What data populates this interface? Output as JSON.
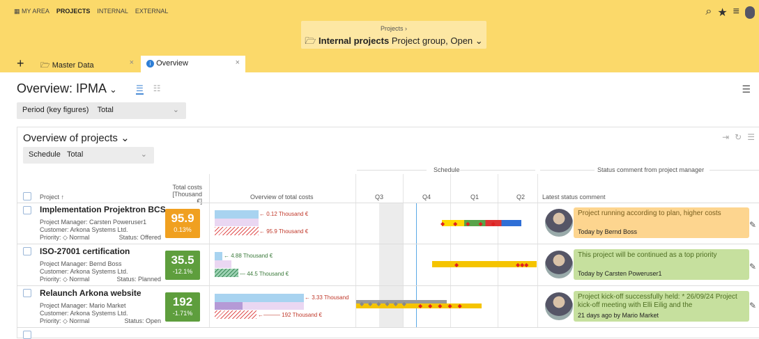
{
  "topnav": {
    "my_area": "MY AREA",
    "projects": "PROJECTS",
    "internal": "INTERNAL",
    "external": "EXTERNAL"
  },
  "selector": {
    "breadcrumb": "Projects ›",
    "name": "Internal projects",
    "detail": "Project group, Open"
  },
  "tabs": [
    {
      "label": "Master Data"
    },
    {
      "label": "Overview"
    }
  ],
  "page": {
    "title": "Overview: IPMA"
  },
  "filters": {
    "period_label": "Period (key figures)",
    "period_value": "Total",
    "schedule_label": "Schedule",
    "schedule_value": "Total"
  },
  "panel": {
    "title": "Overview of projects"
  },
  "headers": {
    "project": "Project ↑",
    "total_costs_1": "Total costs",
    "total_costs_2": "[Thousand €]",
    "overview_costs": "Overview of total costs",
    "schedule_group": "Schedule",
    "quarters": [
      "Q3",
      "Q4",
      "Q1",
      "Q2"
    ],
    "status_group": "Status comment from project manager",
    "latest_comment": "Latest status comment"
  },
  "rows": [
    {
      "title": "Implementation Projektron BCS",
      "pm": "Project Manager: Carsten Poweruser1",
      "customer": "Customer: Arkona Systems Ltd.",
      "priority": "Priority:  ◇ Normal",
      "status": "Status: Offered",
      "kpi_value": "95.9",
      "kpi_pct": "0.13%",
      "kpi_color": "#f0a020",
      "bar_label_1": "0.12 Thousand €",
      "bar_label_2": "95.9 Thousand €",
      "comment_text": "Project running according to plan, higher costs",
      "comment_footer": "Today by Bernd Boss",
      "comment_color": "#fdd58f"
    },
    {
      "title": "ISO-27001 certification",
      "pm": "Project Manager: Bernd Boss",
      "customer": "Customer: Arkona Systems Ltd.",
      "priority": "Priority:  ◇ Normal",
      "status": "Status: Planned",
      "kpi_value": "35.5",
      "kpi_pct": "-12.1%",
      "kpi_color": "#5e9e3d",
      "bar_label_1": "4.88 Thousand €",
      "bar_label_2": "44.5 Thousand €",
      "comment_text": "This project will be continued as a top priority",
      "comment_footer": "Today by Carsten Poweruser1",
      "comment_color": "#c6e09e"
    },
    {
      "title": "Relaunch Arkona website",
      "pm": "Project Manager: Mario Market",
      "customer": "Customer: Arkona Systems Ltd.",
      "priority": "Priority:  ◇ Normal",
      "status": "Status: Open",
      "kpi_value": "192",
      "kpi_pct": "-1.71%",
      "kpi_color": "#5e9e3d",
      "bar_label_1": "3.33 Thousand",
      "bar_label_2": "192 Thousand €",
      "comment_text": "Project kick-off successfully held: * 26/09/24 Project kick-off meeting with Elli Eilig and the",
      "comment_footer": "21 days ago by Mario Market",
      "comment_color": "#c6e09e"
    }
  ]
}
